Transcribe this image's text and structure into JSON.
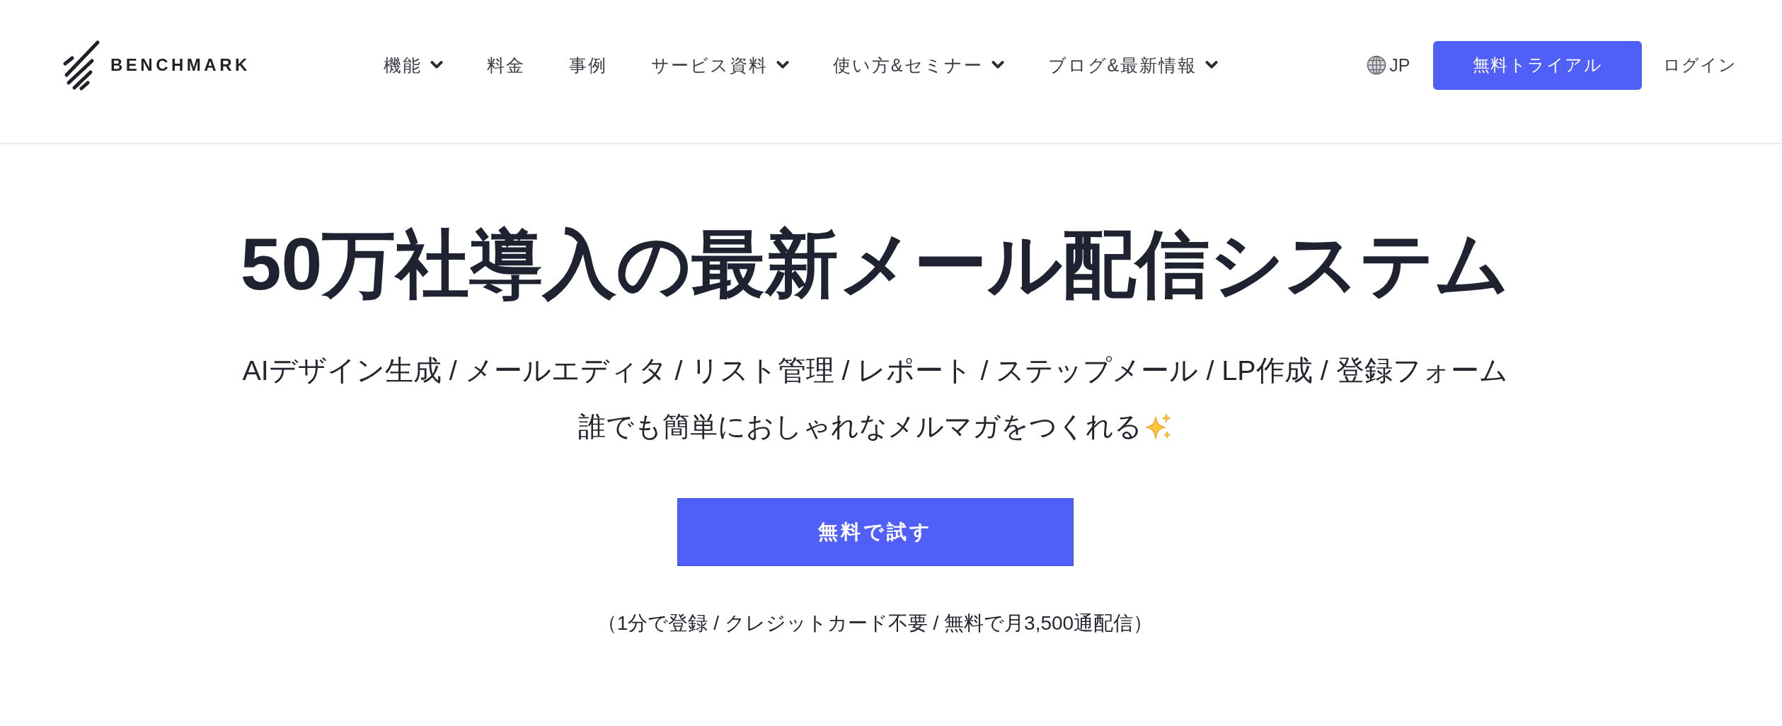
{
  "header": {
    "logo": {
      "brand": "BENCHMARK"
    },
    "nav": [
      {
        "label": "機能",
        "has_menu": true
      },
      {
        "label": "料金",
        "has_menu": false
      },
      {
        "label": "事例",
        "has_menu": false
      },
      {
        "label": "サービス資料",
        "has_menu": true
      },
      {
        "label": "使い方&セミナー",
        "has_menu": true
      },
      {
        "label": "ブログ&最新情報",
        "has_menu": true
      }
    ],
    "language": {
      "label": "JP"
    },
    "trial_button": {
      "label": "無料トライアル"
    },
    "login_link": {
      "label": "ログイン"
    }
  },
  "hero": {
    "title": "50万社導入の最新メール配信システム",
    "features": "AIデザイン生成 / メールエディタ / リスト管理 / レポート / ステップメール / LP作成 / 登録フォーム",
    "tagline": "誰でも簡単におしゃれなメルマガをつくれる",
    "cta_button": {
      "label": "無料で試す"
    },
    "note": "（1分で登録 / クレジットカード不要 / 無料で月3,500通配信）"
  }
}
